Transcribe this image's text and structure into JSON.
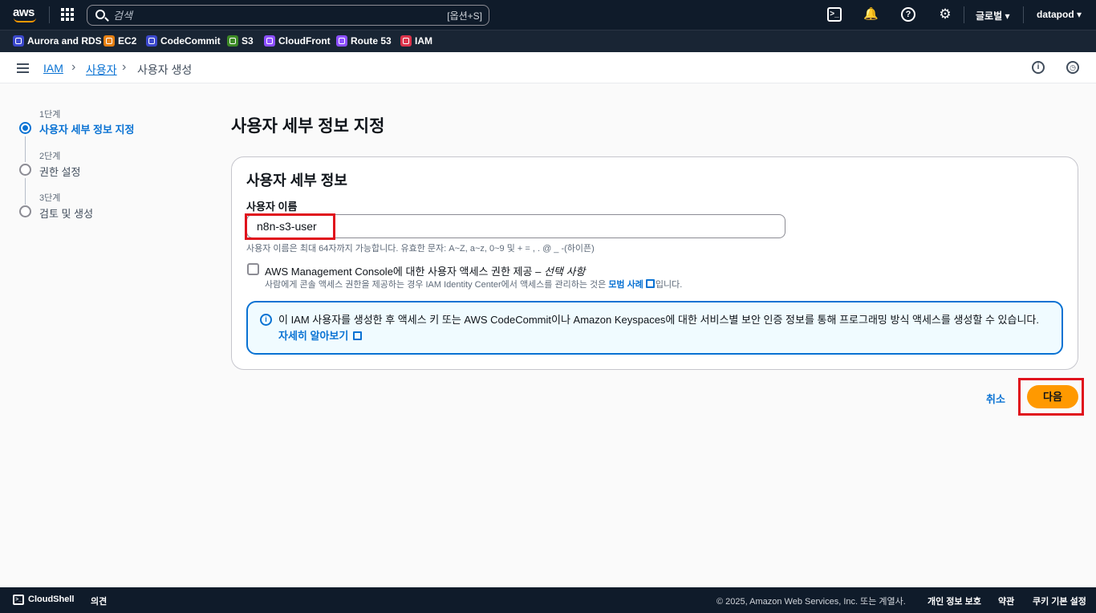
{
  "topbar": {
    "logo_text": "aws",
    "search_placeholder": "검색",
    "search_shortcut": "[옵션+S]",
    "region": "글로벌",
    "account": "datapod",
    "icons": [
      "cloudshell-icon",
      "bell-icon",
      "help-icon",
      "gear-icon"
    ]
  },
  "favorites": [
    {
      "label": "Aurora and RDS",
      "color": "#3b48cc"
    },
    {
      "label": "EC2",
      "color": "#e57f12"
    },
    {
      "label": "CodeCommit",
      "color": "#3b48cc"
    },
    {
      "label": "S3",
      "color": "#3d8a26"
    },
    {
      "label": "CloudFront",
      "color": "#8c4fff"
    },
    {
      "label": "Route 53",
      "color": "#8c4fff"
    },
    {
      "label": "IAM",
      "color": "#dd344c"
    }
  ],
  "breadcrumb": {
    "items": [
      "IAM",
      "사용자",
      "사용자 생성"
    ]
  },
  "wizard": {
    "steps": [
      {
        "label": "1단계",
        "title": "사용자 세부 정보 지정"
      },
      {
        "label": "2단계",
        "title": "권한 설정"
      },
      {
        "label": "3단계",
        "title": "검토 및 생성"
      }
    ]
  },
  "main": {
    "page_title": "사용자 세부 정보 지정",
    "panel_title": "사용자 세부 정보",
    "username_label": "사용자 이름",
    "username_value": "n8n-s3-user",
    "username_hint": "사용자 이름은 최대 64자까지 가능합니다. 유효한 문자: A~Z, a~z, 0~9 및 + = , . @ _ -(하이픈)",
    "console_access_label": "AWS Management Console에 대한 사용자 액세스 권한 제공 – ",
    "console_access_optional": "선택 사항",
    "console_access_desc": "사람에게 콘솔 액세스 권한을 제공하는 경우 IAM Identity Center에서 액세스를 관리하는 것은 ",
    "console_access_link": "모범 사례",
    "console_access_desc_end": "입니다.",
    "alert_text": "이 IAM 사용자를 생성한 후 액세스 키 또는 AWS CodeCommit이나 Amazon Keyspaces에 대한 서비스별 보안 인증 정보를 통해 프로그래밍 방식 액세스를 생성할 수 있습니다. ",
    "alert_link": "자세히 알아보기"
  },
  "actions": {
    "cancel_label": "취소",
    "next_label": "다음"
  },
  "footer": {
    "cloudshell": "CloudShell",
    "feedback": "의견",
    "copyright": "© 2025, Amazon Web Services, Inc. 또는 계열사.",
    "privacy": "개인 정보 보호",
    "terms": "약관",
    "cookies": "쿠키 기본 설정"
  }
}
